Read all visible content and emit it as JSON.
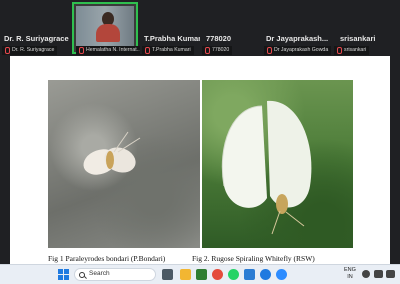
{
  "participants": [
    {
      "name": "Dr. R. Suriyagrace",
      "tag": "Dr. R. Suriyagrace",
      "active": false
    },
    {
      "name": "",
      "tag": "Hemalatha N. Internat...",
      "active": true
    },
    {
      "name": "T.Prabha Kumari",
      "tag": "T.Prabha Kumari",
      "active": false
    },
    {
      "name": "778020",
      "tag": "778020",
      "active": false
    },
    {
      "name": "Dr  Jayaprakash...",
      "tag": "Dr Jayaprakash Gowda",
      "active": false
    },
    {
      "name": "srisankari",
      "tag": "srisankari",
      "active": false
    }
  ],
  "slide": {
    "caption1": "Fig 1 Paraleyrodes bondari (P.Bondari)",
    "caption2": "Fig 2. Rugose Spiraling Whitefly (RSW)"
  },
  "taskbar": {
    "search_label": "Search",
    "lang_top": "ENG",
    "lang_bottom": "IN",
    "colors": {
      "accent": "#1f7ae0",
      "active_border": "#2fbf4f",
      "mute": "#e5484d"
    }
  }
}
